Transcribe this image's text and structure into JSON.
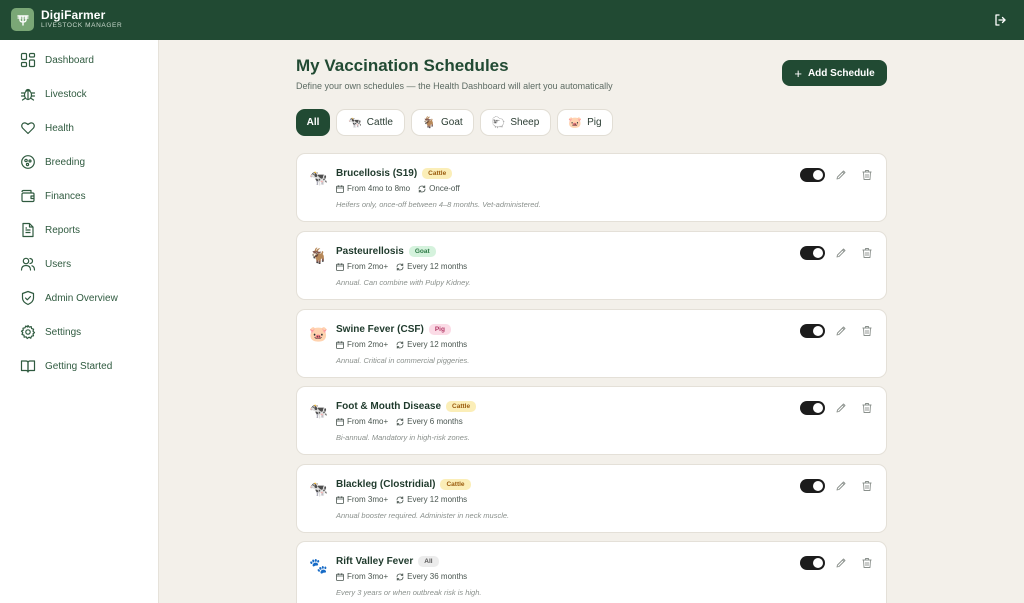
{
  "app": {
    "name": "DigiFarmer",
    "subtitle": "LIVESTOCK MANAGER"
  },
  "sidebar": {
    "items": [
      {
        "label": "Dashboard",
        "icon": "grid-icon"
      },
      {
        "label": "Livestock",
        "icon": "bug-icon"
      },
      {
        "label": "Health",
        "icon": "heart-icon"
      },
      {
        "label": "Breeding",
        "icon": "breeding-icon"
      },
      {
        "label": "Finances",
        "icon": "wallet-icon"
      },
      {
        "label": "Reports",
        "icon": "document-icon"
      },
      {
        "label": "Users",
        "icon": "users-icon"
      },
      {
        "label": "Admin Overview",
        "icon": "shield-check-icon"
      },
      {
        "label": "Settings",
        "icon": "gear-icon"
      },
      {
        "label": "Getting Started",
        "icon": "book-icon"
      }
    ]
  },
  "main": {
    "title": "My Vaccination Schedules",
    "subtitle": "Define your own schedules — the Health Dashboard will alert you automatically",
    "add_button": "Add Schedule",
    "filters": [
      {
        "label": "All",
        "emoji": "",
        "active": true
      },
      {
        "label": "Cattle",
        "emoji": "🐄",
        "active": false
      },
      {
        "label": "Goat",
        "emoji": "🐐",
        "active": false
      },
      {
        "label": "Sheep",
        "emoji": "🐑",
        "active": false
      },
      {
        "label": "Pig",
        "emoji": "🐷",
        "active": false
      }
    ],
    "schedules": [
      {
        "name": "Brucellosis (S19)",
        "badge": "Cattle",
        "badge_type": "cattle",
        "animal": "🐄",
        "from": "From 4mo to 8mo",
        "freq": "Once-off",
        "note": "Heifers only, once-off between 4–8 months. Vet-administered.",
        "enabled": true
      },
      {
        "name": "Pasteurellosis",
        "badge": "Goat",
        "badge_type": "goat",
        "animal": "🐐",
        "from": "From 2mo+",
        "freq": "Every 12 months",
        "note": "Annual. Can combine with Pulpy Kidney.",
        "enabled": true
      },
      {
        "name": "Swine Fever (CSF)",
        "badge": "Pig",
        "badge_type": "pig",
        "animal": "🐷",
        "from": "From 2mo+",
        "freq": "Every 12 months",
        "note": "Annual. Critical in commercial piggeries.",
        "enabled": true
      },
      {
        "name": "Foot & Mouth Disease",
        "badge": "Cattle",
        "badge_type": "cattle",
        "animal": "🐄",
        "from": "From 4mo+",
        "freq": "Every 6 months",
        "note": "Bi-annual. Mandatory in high-risk zones.",
        "enabled": true
      },
      {
        "name": "Blackleg (Clostridial)",
        "badge": "Cattle",
        "badge_type": "cattle",
        "animal": "🐄",
        "from": "From 3mo+",
        "freq": "Every 12 months",
        "note": "Annual booster required. Administer in neck muscle.",
        "enabled": true
      },
      {
        "name": "Rift Valley Fever",
        "badge": "All",
        "badge_type": "all",
        "animal": "🐾",
        "from": "From 3mo+",
        "freq": "Every 36 months",
        "note": "Every 3 years or when outbreak risk is high.",
        "enabled": true
      }
    ]
  },
  "colors": {
    "primary": "#214a33",
    "background": "#f3f0ea"
  }
}
